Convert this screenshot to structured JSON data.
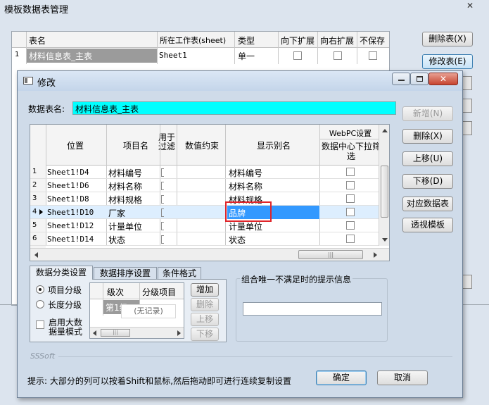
{
  "main_window": {
    "title": "模板数据表管理",
    "close_glyph": "✕",
    "headers": [
      "表名",
      "所在工作表(sheet)",
      "类型",
      "向下扩展",
      "向右扩展",
      "不保存"
    ],
    "row": {
      "num": "1",
      "name": "材料信息表_主表",
      "sheet": "Sheet1",
      "type": "单一"
    },
    "buttons": {
      "delete": "删除表(X)",
      "modify": "修改表(E)"
    }
  },
  "dialog": {
    "title": "修改",
    "name_label": "数据表名:",
    "name_value": "材料信息表_主表",
    "headers": {
      "position": "位置",
      "item": "项目名",
      "filter": "用于\n过滤",
      "constraint": "数值约束",
      "alias": "显示别名",
      "webpc": "WebPC设置",
      "webpc_sub": "数据中心下拉筛选"
    },
    "rows": [
      {
        "num": "1",
        "pos": "Sheet1!D4",
        "item": "材料编号",
        "alias": "材料编号",
        "current": false
      },
      {
        "num": "2",
        "pos": "Sheet1!D6",
        "item": "材料名称",
        "alias": "材料名称",
        "current": false
      },
      {
        "num": "3",
        "pos": "Sheet1!D8",
        "item": "材料规格",
        "alias": "材料规格",
        "current": false
      },
      {
        "num": "4",
        "pos": "Sheet1!D10",
        "item": "厂家",
        "alias": "品牌",
        "current": true
      },
      {
        "num": "5",
        "pos": "Sheet1!D12",
        "item": "计量单位",
        "alias": "计量单位",
        "current": false
      },
      {
        "num": "6",
        "pos": "Sheet1!D14",
        "item": "状态",
        "alias": "状态",
        "current": false
      }
    ],
    "right_buttons": {
      "add": "新增(N)",
      "delete": "删除(X)",
      "up": "上移(U)",
      "down": "下移(D)",
      "map": "对应数据表",
      "pivot": "透视模板"
    },
    "tabs": [
      "数据分类设置",
      "数据排序设置",
      "条件格式"
    ],
    "classify": {
      "radio_item": "项目分级",
      "radio_length": "长度分级",
      "bigdata_checkbox": "启用大数据量模式",
      "headers": [
        "级次",
        "分级项目"
      ],
      "first_level": "第1级",
      "no_record": "(无记录)",
      "buttons": {
        "add": "增加",
        "delete": "删除",
        "up": "上移",
        "down": "下移"
      }
    },
    "unique_group_label": "组合唯一不满足时的提示信息",
    "unique_value": "",
    "brand": "SSSoft",
    "hint": "提示: 大部分的列可以按着Shift和鼠标,然后拖动即可进行连续复制设置",
    "ok": "确定",
    "cancel": "取消"
  },
  "colors": {
    "highlight": "#00ffff",
    "selected_cell": "#3399ff",
    "red_box": "#e0252a"
  }
}
